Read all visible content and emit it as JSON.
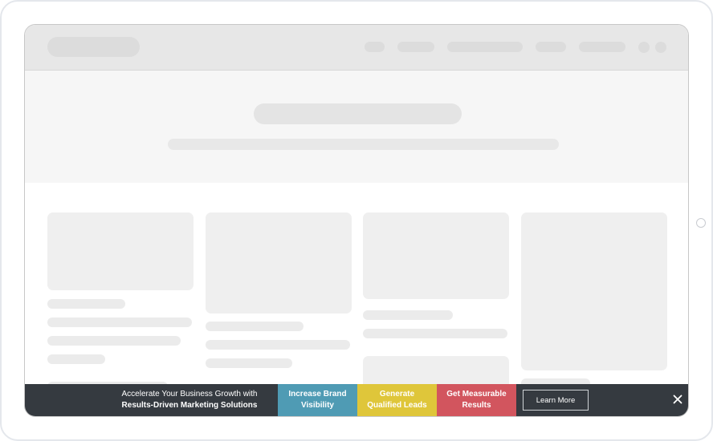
{
  "promo_bar": {
    "line1": "Accelerate Your Business Growth with",
    "line2": "Results-Driven Marketing Solutions",
    "segments": [
      {
        "label": "Increase Brand Visibility",
        "color": "#4f9bb4"
      },
      {
        "label": "Generate Qualified Leads",
        "color": "#dfc63a"
      },
      {
        "label": "Get Measurable Results",
        "color": "#d2555e"
      }
    ],
    "cta_label": "Learn More",
    "background": "#353a40"
  }
}
